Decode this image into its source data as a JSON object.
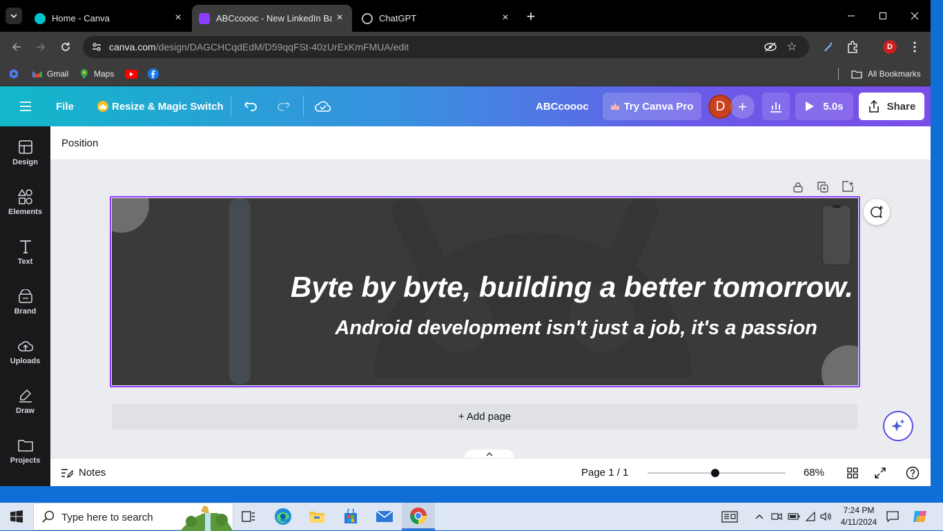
{
  "browser": {
    "tabs": [
      {
        "title": "Home - Canva",
        "favicon": "canva-icon",
        "color": "#00c4cc"
      },
      {
        "title": "ABCcoooc - New LinkedIn Bann",
        "favicon": "canva-heart-icon",
        "color": "#8b3dff"
      },
      {
        "title": "ChatGPT",
        "favicon": "chatgpt-icon",
        "color": "#a0a0a0"
      }
    ],
    "url_domain": "canva.com",
    "url_path": "/design/DAGCHCqdEdM/D59qqFSt-40zUrExKmFMUA/edit",
    "profile_initial": "D",
    "bookmarks": [
      {
        "label": "Gmail",
        "icon": "gmail-icon"
      },
      {
        "label": "Maps",
        "icon": "maps-icon"
      },
      {
        "label": "",
        "icon": "youtube-icon"
      },
      {
        "label": "",
        "icon": "facebook-icon"
      }
    ],
    "all_bookmarks_label": "All Bookmarks"
  },
  "canva": {
    "header": {
      "file_label": "File",
      "resize_label": "Resize & Magic Switch",
      "design_title": "ABCcoooc",
      "try_pro_label": "Try Canva Pro",
      "avatar_initial": "D",
      "play_label": "5.0s",
      "share_label": "Share"
    },
    "rail": [
      {
        "label": "Design",
        "icon": "design-icon"
      },
      {
        "label": "Elements",
        "icon": "elements-icon"
      },
      {
        "label": "Text",
        "icon": "text-icon"
      },
      {
        "label": "Brand",
        "icon": "brand-icon"
      },
      {
        "label": "Uploads",
        "icon": "uploads-icon"
      },
      {
        "label": "Draw",
        "icon": "draw-icon"
      },
      {
        "label": "Projects",
        "icon": "projects-icon"
      }
    ],
    "position_label": "Position",
    "design": {
      "headline": "Byte by byte, building a better tomorrow.",
      "subhead": "Android development isn't just a job, it's a passion",
      "background": "#3a3a3a"
    },
    "add_page_label": "+ Add page",
    "bottom": {
      "notes_label": "Notes",
      "page_label": "Page 1 / 1",
      "zoom_label": "68%",
      "zoom_level": 0.49
    }
  },
  "taskbar": {
    "search_placeholder": "Type here to search",
    "time": "7:24 PM",
    "date": "4/11/2024"
  },
  "colors": {
    "accent": "#8b3dff",
    "canva_header_start": "#12b8ca",
    "canva_header_end": "#7a4ee8",
    "avatar": "#c0392b"
  }
}
